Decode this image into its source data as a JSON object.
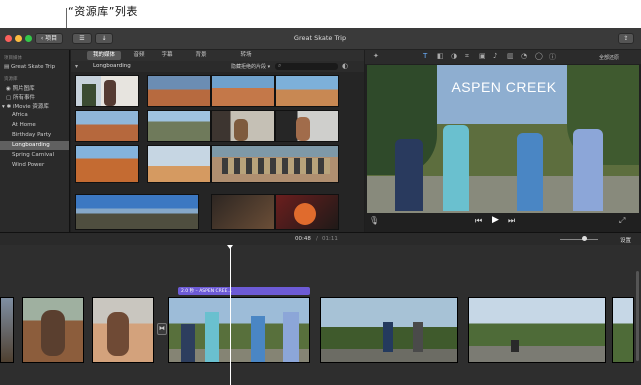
{
  "annotation": {
    "caption": "“资源库”列表"
  },
  "window": {
    "title": "Great Skate Trip",
    "back_label": "项目",
    "share_icon": "share-icon",
    "close_color": "#fc605c",
    "min_color": "#fdbc40",
    "max_color": "#34c84a"
  },
  "sidebar": {
    "section_project": "项目媒体",
    "project": "Great Skate Trip",
    "section_library": "资源库",
    "photos": "照片图库",
    "all_events": "所有事件",
    "library": "iMovie 资源库",
    "events": [
      "Africa",
      "At Home",
      "Birthday Party",
      "Longboarding",
      "Spring Carnival",
      "Wind Power"
    ],
    "selected_event": "Longboarding"
  },
  "browser": {
    "tabs": [
      "我的媒体",
      "音频",
      "字幕",
      "背景",
      "转场"
    ],
    "active_tab": "我的媒体",
    "event_label": "Longboarding",
    "filter_label": "隐藏拒绝的片段",
    "search_placeholder": "搜索"
  },
  "viewer": {
    "reset_label": "全部还原",
    "title_overlay": "ASPEN CREEK"
  },
  "transport": {
    "timecode": "00:48",
    "duration": "01:11",
    "settings_label": "设置"
  },
  "timeline": {
    "title_clip_label": "2.0 秒 – ASPEN CREE…"
  }
}
